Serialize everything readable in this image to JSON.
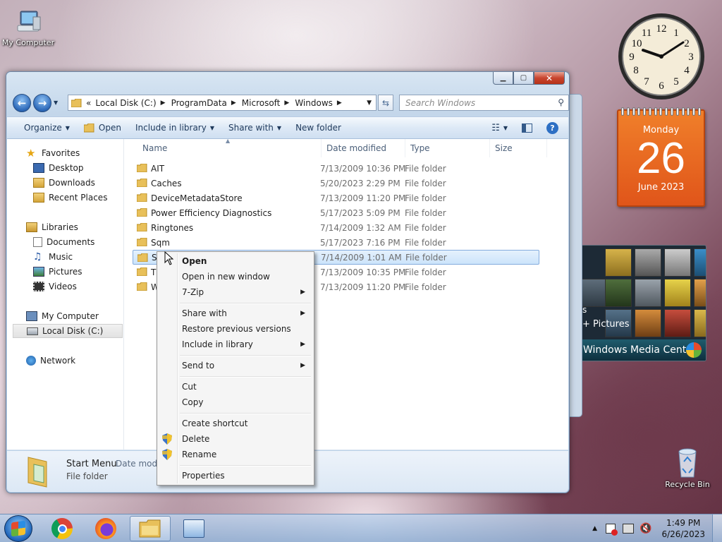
{
  "desktop": {
    "icons": [
      {
        "label": "My Computer"
      },
      {
        "label": "Recycle Bin"
      }
    ]
  },
  "explorer": {
    "breadcrumb": {
      "prefix": "«",
      "segments": [
        "Local Disk (C:)",
        "ProgramData",
        "Microsoft",
        "Windows"
      ]
    },
    "search_placeholder": "Search Windows",
    "toolbar": {
      "organize": "Organize",
      "open": "Open",
      "include_in_library": "Include in library",
      "share_with": "Share with",
      "new_folder": "New folder"
    },
    "nav": {
      "favorites": "Favorites",
      "desktop": "Desktop",
      "downloads": "Downloads",
      "recent_places": "Recent Places",
      "libraries": "Libraries",
      "documents": "Documents",
      "music": "Music",
      "pictures": "Pictures",
      "videos": "Videos",
      "my_computer": "My Computer",
      "local_disk": "Local Disk (C:)",
      "network": "Network"
    },
    "columns": {
      "name": "Name",
      "date": "Date modified",
      "type": "Type",
      "size": "Size"
    },
    "files": [
      {
        "name": "AIT",
        "date": "7/13/2009 10:36 PM",
        "type": "File folder"
      },
      {
        "name": "Caches",
        "date": "5/20/2023 2:29 PM",
        "type": "File folder"
      },
      {
        "name": "DeviceMetadataStore",
        "date": "7/13/2009 11:20 PM",
        "type": "File folder"
      },
      {
        "name": "Power Efficiency Diagnostics",
        "date": "5/17/2023 5:09 PM",
        "type": "File folder"
      },
      {
        "name": "Ringtones",
        "date": "7/14/2009 1:32 AM",
        "type": "File folder"
      },
      {
        "name": "Sqm",
        "date": "5/17/2023 7:16 PM",
        "type": "File folder"
      },
      {
        "name": "St",
        "date": "7/14/2009 1:01 AM",
        "type": "File folder"
      },
      {
        "name": "T",
        "date": "7/13/2009 10:35 PM",
        "type": "File folder"
      },
      {
        "name": "W",
        "date": "7/13/2009 11:20 PM",
        "type": "File folder"
      }
    ],
    "details": {
      "name": "Start Menu",
      "type": "File folder",
      "date_label": "Date modif"
    }
  },
  "context_menu": {
    "open": "Open",
    "open_new_window": "Open in new window",
    "seven_zip": "7-Zip",
    "share_with": "Share with",
    "restore_previous": "Restore previous versions",
    "include_in_library": "Include in library",
    "send_to": "Send to",
    "cut": "Cut",
    "copy": "Copy",
    "create_shortcut": "Create shortcut",
    "delete": "Delete",
    "rename": "Rename",
    "properties": "Properties"
  },
  "gadgets": {
    "calendar": {
      "weekday": "Monday",
      "day": "26",
      "month_year": "June 2023"
    },
    "clock": {
      "numerals": [
        "12",
        "1",
        "2",
        "3",
        "4",
        "5",
        "6",
        "7",
        "8",
        "9",
        "10",
        "11"
      ]
    },
    "media_center": {
      "label_partial": "s",
      "pictures": "+ Pictures",
      "title": "Windows Media Center"
    }
  },
  "taskbar": {
    "time": "1:49 PM",
    "date": "6/26/2023",
    "tray_chevron": "▲"
  },
  "colors": {
    "selection": "#cce4fb",
    "calendar_orange": "#e0551a",
    "folder_yellow": "#e8c05a"
  }
}
